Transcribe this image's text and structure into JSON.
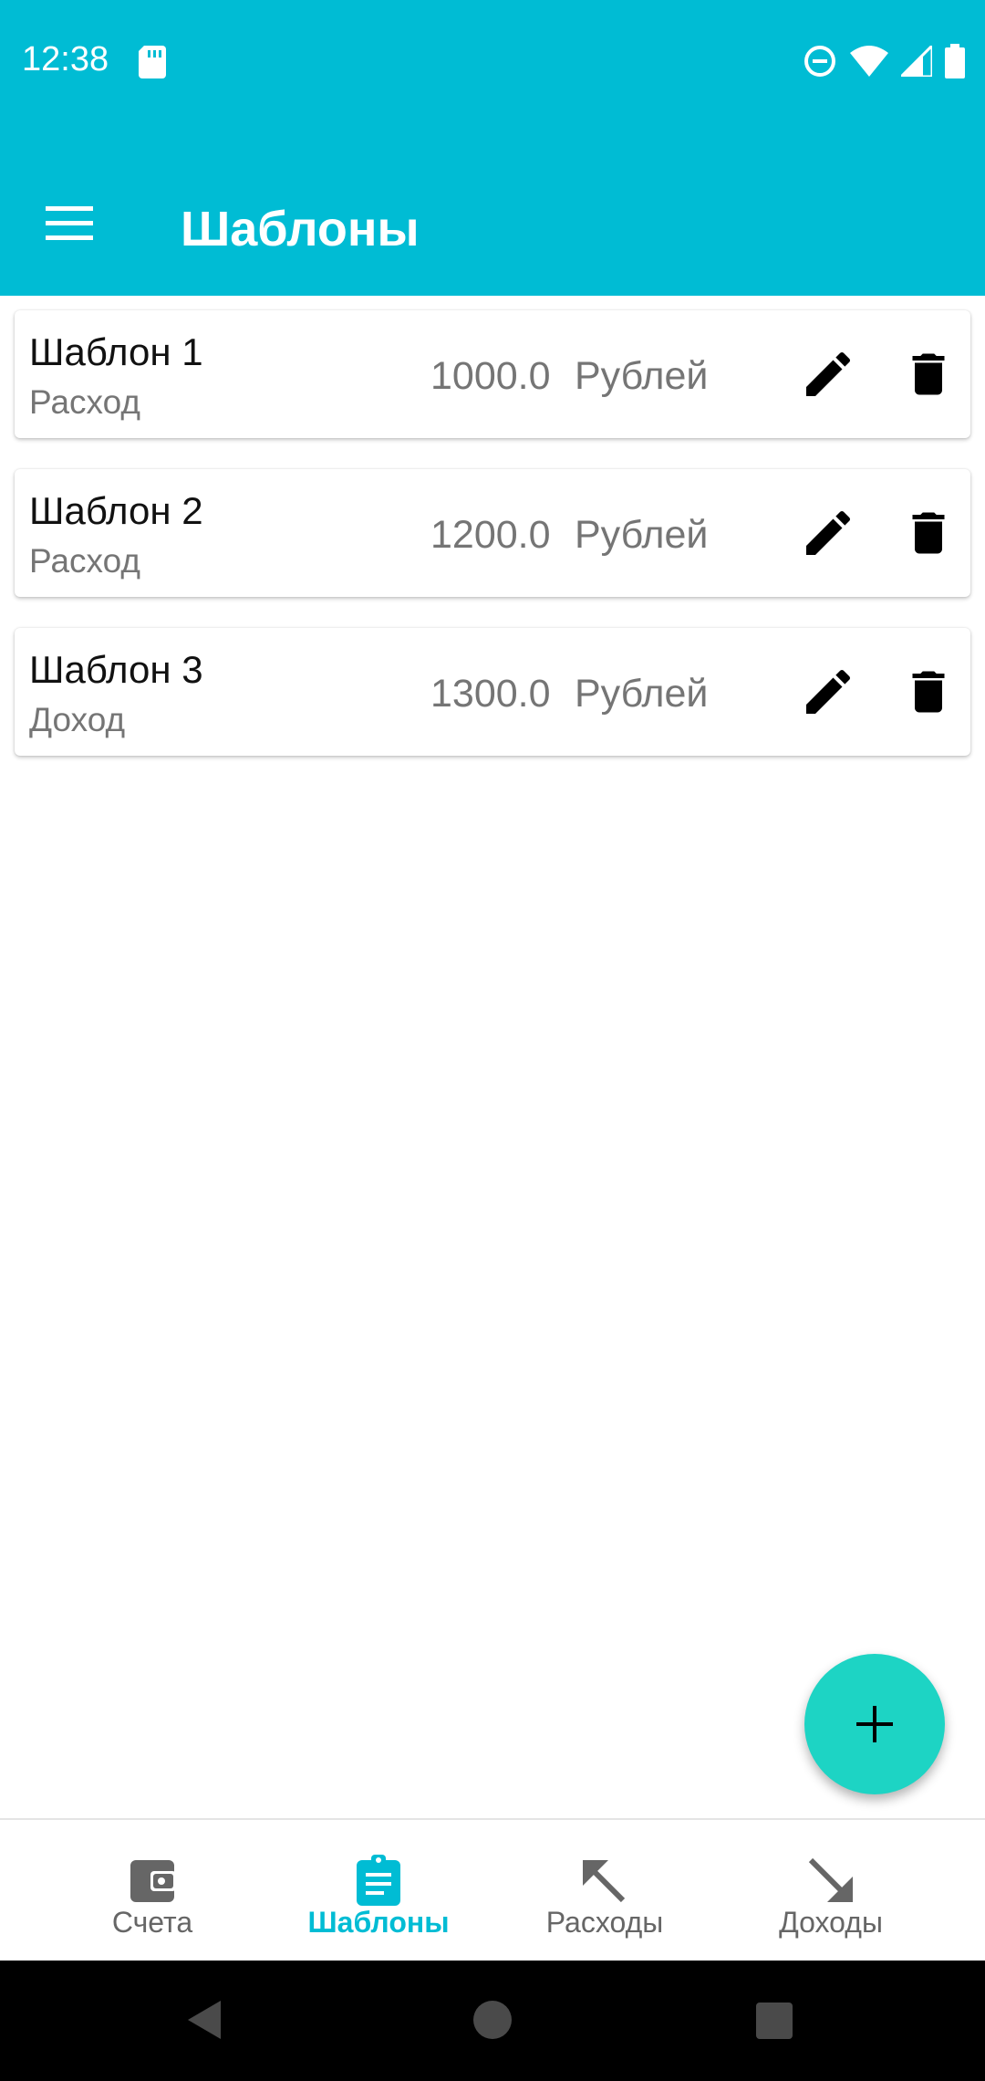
{
  "colors": {
    "primary": "#00bcd4",
    "fab": "#1dd4c4",
    "accent": "#00bcd4"
  },
  "status_bar": {
    "time": "12:38",
    "icons": [
      "sd-card-icon",
      "dnd-icon",
      "wifi-icon",
      "signal-icon",
      "battery-icon"
    ]
  },
  "app_bar": {
    "title": "Шаблоны",
    "menu_icon": "menu-icon"
  },
  "templates": [
    {
      "name": "Шаблон 1",
      "type": "Расход",
      "amount": "1000.0",
      "currency": "Рублей"
    },
    {
      "name": "Шаблон 2",
      "type": "Расход",
      "amount": "1200.0",
      "currency": "Рублей"
    },
    {
      "name": "Шаблон 3",
      "type": "Доход",
      "amount": "1300.0",
      "currency": "Рублей"
    }
  ],
  "fab": {
    "icon": "plus-icon"
  },
  "bottom_nav": {
    "items": [
      {
        "label": "Счета",
        "icon": "wallet-icon",
        "active": false
      },
      {
        "label": "Шаблоны",
        "icon": "clipboard-icon",
        "active": true
      },
      {
        "label": "Расходы",
        "icon": "arrow-up-left-icon",
        "active": false
      },
      {
        "label": "Доходы",
        "icon": "arrow-down-right-icon",
        "active": false
      }
    ]
  }
}
